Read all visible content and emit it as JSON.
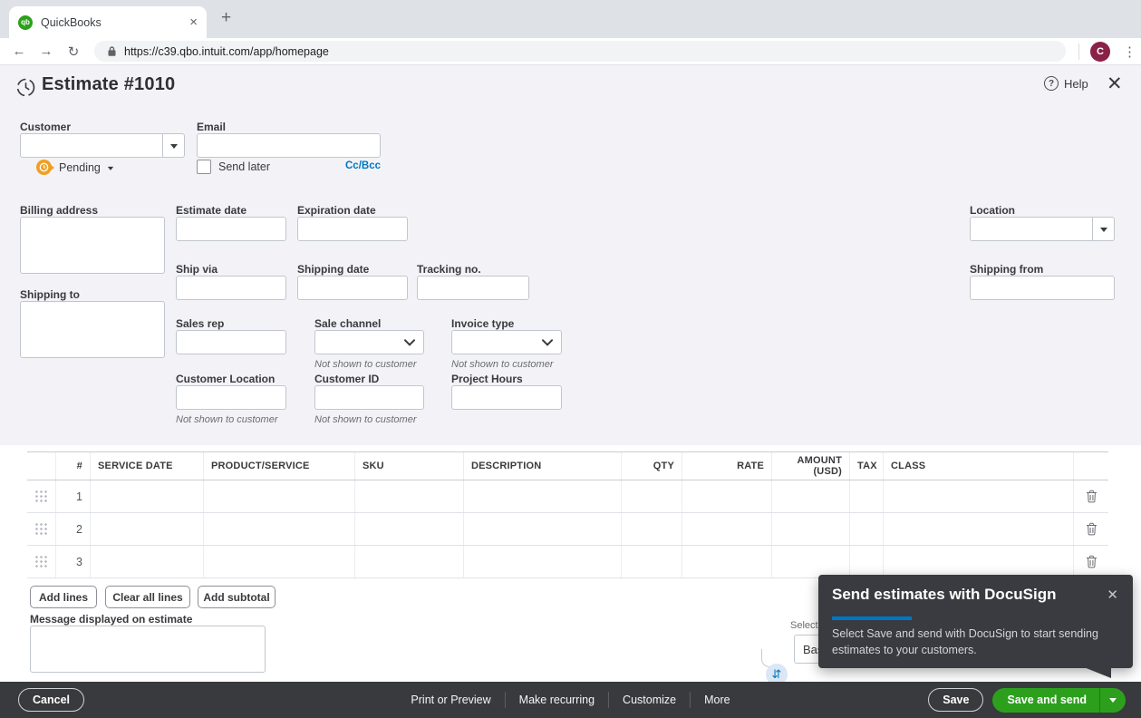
{
  "browser": {
    "tab_title": "QuickBooks",
    "url": "https://c39.qbo.intuit.com/app/homepage",
    "avatar_letter": "C"
  },
  "header": {
    "title": "Estimate #1010",
    "help_label": "Help"
  },
  "form": {
    "customer_label": "Customer",
    "email_label": "Email",
    "status_label": "Pending",
    "send_later_label": "Send later",
    "cc_bcc_label": "Cc/Bcc",
    "billing_address_label": "Billing address",
    "estimate_date_label": "Estimate date",
    "expiration_date_label": "Expiration date",
    "location_label": "Location",
    "ship_via_label": "Ship via",
    "shipping_date_label": "Shipping date",
    "tracking_no_label": "Tracking no.",
    "shipping_from_label": "Shipping from",
    "shipping_to_label": "Shipping to",
    "sales_rep_label": "Sales rep",
    "sale_channel_label": "Sale channel",
    "invoice_type_label": "Invoice type",
    "customer_location_label": "Customer Location",
    "customer_id_label": "Customer ID",
    "project_hours_label": "Project Hours",
    "not_shown_note": "Not shown to customer"
  },
  "line_items": {
    "columns": [
      "#",
      "SERVICE DATE",
      "PRODUCT/SERVICE",
      "SKU",
      "DESCRIPTION",
      "QTY",
      "RATE",
      "AMOUNT (USD)",
      "TAX",
      "CLASS"
    ],
    "rows": [
      {
        "num": "1"
      },
      {
        "num": "2"
      },
      {
        "num": "3"
      }
    ]
  },
  "table_actions": {
    "add_lines": "Add lines",
    "clear_all_lines": "Clear all lines",
    "add_subtotal": "Add subtotal"
  },
  "message_label": "Message displayed on estimate",
  "tax_section": {
    "select_label": "Select",
    "dropdown_value_visible": "Bas"
  },
  "docusign_popup": {
    "title": "Send estimates with DocuSign",
    "body": "Select Save and send with DocuSign to start sending estimates to your customers."
  },
  "footer": {
    "cancel": "Cancel",
    "print_or_preview": "Print or Preview",
    "make_recurring": "Make recurring",
    "customize": "Customize",
    "more": "More",
    "save": "Save",
    "save_and_send": "Save and send"
  },
  "colors": {
    "accent_green": "#2ca01c",
    "link_blue": "#0077c5",
    "footer_bg": "#393a3d",
    "popup_bg": "#393b40",
    "pending_orange": "#efa023",
    "avatar_bg": "#8a2146"
  }
}
